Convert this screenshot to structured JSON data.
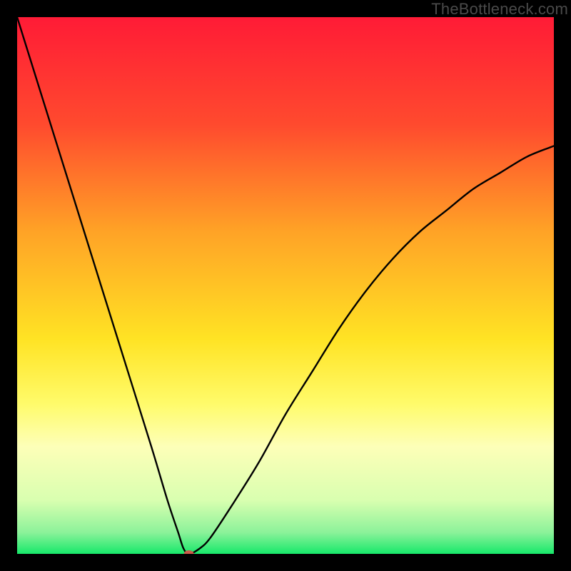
{
  "watermark": "TheBottleneck.com",
  "chart_data": {
    "type": "line",
    "title": "",
    "xlabel": "",
    "ylabel": "",
    "xlim": [
      0,
      100
    ],
    "ylim": [
      0,
      100
    ],
    "grid": false,
    "legend": false,
    "series": [
      {
        "name": "curve",
        "x": [
          0,
          5,
          10,
          15,
          20,
          25,
          28,
          30,
          31,
          32,
          34,
          36,
          40,
          45,
          50,
          55,
          60,
          65,
          70,
          75,
          80,
          85,
          90,
          95,
          100
        ],
        "y": [
          100,
          84,
          68,
          52,
          36,
          20,
          10,
          4,
          1,
          0,
          1,
          3,
          9,
          17,
          26,
          34,
          42,
          49,
          55,
          60,
          64,
          68,
          71,
          74,
          76
        ]
      }
    ],
    "marker": {
      "x": 32,
      "y": 0,
      "color": "#cc5a4a",
      "rx": 7,
      "ry": 5
    },
    "gradient_stops": [
      {
        "offset": 0.0,
        "color": "#ff1b36"
      },
      {
        "offset": 0.2,
        "color": "#ff4a2e"
      },
      {
        "offset": 0.4,
        "color": "#ffa326"
      },
      {
        "offset": 0.6,
        "color": "#ffe324"
      },
      {
        "offset": 0.72,
        "color": "#fffb6a"
      },
      {
        "offset": 0.8,
        "color": "#fdffb8"
      },
      {
        "offset": 0.9,
        "color": "#d9ffb0"
      },
      {
        "offset": 0.96,
        "color": "#8cf29a"
      },
      {
        "offset": 1.0,
        "color": "#17e86a"
      }
    ]
  }
}
